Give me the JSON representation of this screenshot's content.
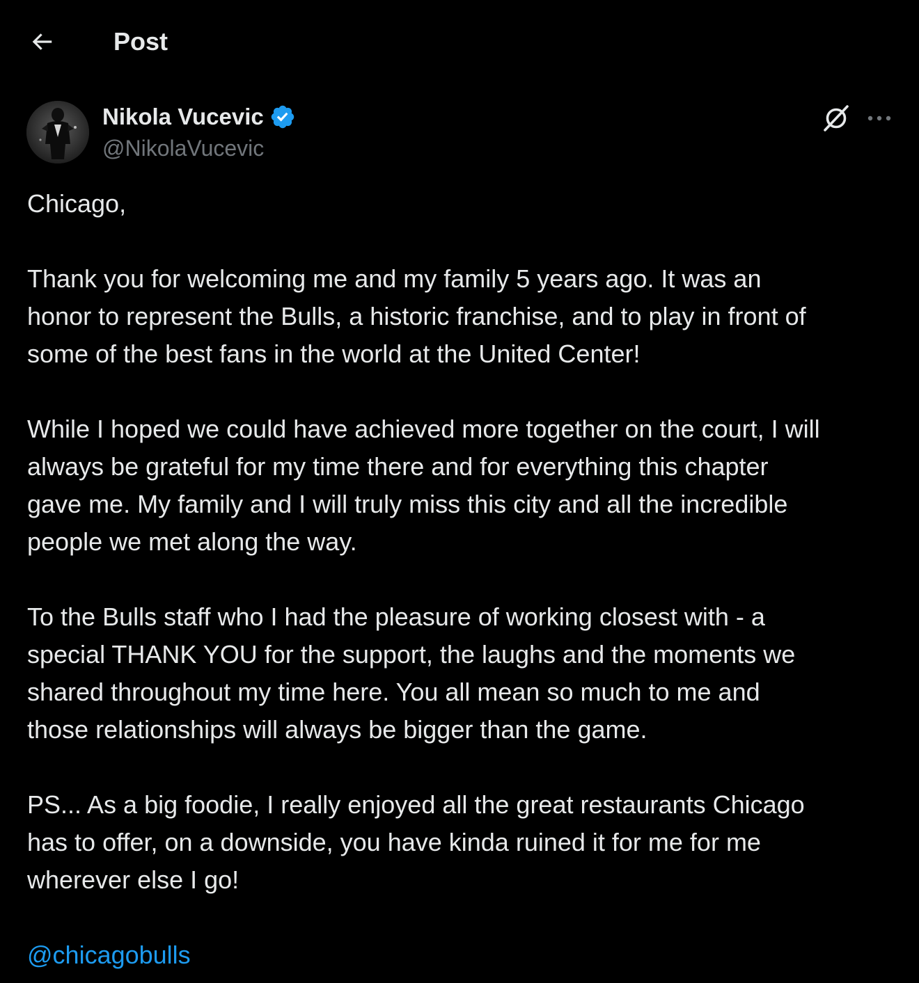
{
  "header": {
    "title": "Post",
    "back_icon": "arrow-left-icon"
  },
  "author": {
    "display_name": "Nikola Vucevic",
    "handle": "@NikolaVucevic",
    "verified": true,
    "verified_color": "#1d9bf0"
  },
  "actions": {
    "grok_icon": "grok-icon",
    "more_icon": "more-horizontal-icon"
  },
  "post": {
    "greeting": "Chicago,",
    "paragraph_1": [
      "Thank you for welcoming me and my family 5 years ago. It was an",
      "honor to represent the Bulls, a historic franchise, and to play in front of",
      "some of the best fans in the world at the United Center!"
    ],
    "paragraph_2": [
      "While I hoped we could have achieved more together on the court, I will",
      "always be grateful for my time there and for everything this chapter",
      "gave me. My family and I will truly miss this city and all the incredible",
      "people we met along the way."
    ],
    "paragraph_3": [
      "To the Bulls staff who I had the pleasure of working closest with - a",
      "special THANK YOU for the support, the laughs and the moments we",
      "shared throughout my time here. You all mean so much to me and",
      "those relationships will always be bigger than the game."
    ],
    "paragraph_4": [
      "PS... As a big foodie, I really enjoyed all the great restaurants Chicago",
      "has to offer, on a downside, you have kinda ruined it for me for me",
      "wherever else I go!"
    ],
    "mention": "@chicagobulls"
  },
  "colors": {
    "background": "#000000",
    "text": "#e7e9ea",
    "secondary_text": "#71767b",
    "link": "#1d9bf0"
  }
}
